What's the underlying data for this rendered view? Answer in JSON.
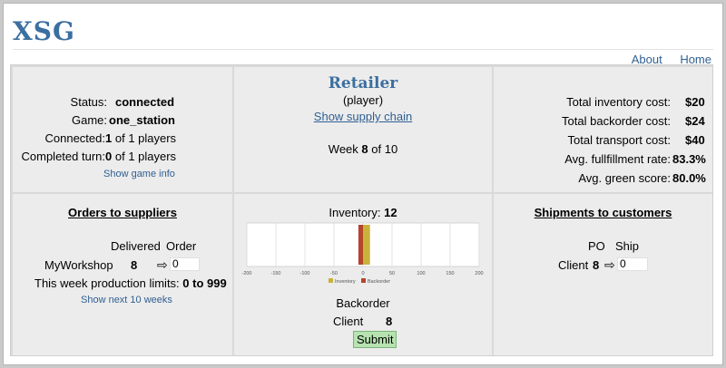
{
  "app": {
    "logo": "XSG"
  },
  "nav": {
    "about": "About",
    "home": "Home"
  },
  "status_panel": {
    "status_label": "Status:",
    "status_value": "connected",
    "game_label": "Game:",
    "game_value": "one_station",
    "connected_label": "Connected:",
    "connected_count": "1",
    "connected_suffix": "of 1 players",
    "completed_label": "Completed turn:",
    "completed_count": "0",
    "completed_suffix": "of 1 players",
    "show_game_info": "Show game info"
  },
  "role_panel": {
    "role": "Retailer",
    "role_type": "(player)",
    "show_supply_chain": "Show supply chain",
    "week_prefix": "Week",
    "week_current": "8",
    "week_suffix": "of 10"
  },
  "costs_panel": {
    "rows": [
      {
        "label": "Total inventory cost:",
        "value": "$20"
      },
      {
        "label": "Total backorder cost:",
        "value": "$24"
      },
      {
        "label": "Total transport cost:",
        "value": "$40"
      },
      {
        "label": "Avg. fullfillment rate:",
        "value": "83.3%"
      },
      {
        "label": "Avg. green score:",
        "value": "80.0%"
      }
    ]
  },
  "orders_panel": {
    "title": "Orders to suppliers",
    "col_delivered": "Delivered",
    "col_order": "Order",
    "supplier_name": "MyWorkshop",
    "supplier_delivered": "8",
    "arrow": "⇨",
    "order_value": "0",
    "limits_label": "This week production limits:",
    "limits_value": "0 to 999",
    "show_next": "Show next 10 weeks"
  },
  "inventory_panel": {
    "inventory_label": "Inventory:",
    "inventory_value": "12",
    "backorder_label": "Backorder",
    "client_label": "Client",
    "client_backorder": "8",
    "submit_label": "Submit"
  },
  "shipments_panel": {
    "title": "Shipments to customers",
    "col_po": "PO",
    "col_ship": "Ship",
    "client_label": "Client",
    "client_po": "8",
    "arrow": "⇨",
    "ship_value": "0"
  },
  "chart_data": {
    "type": "bar",
    "orientation": "horizontal",
    "series": [
      {
        "name": "Inventory",
        "values": [
          12
        ]
      },
      {
        "name": "Backorder",
        "values": [
          -8
        ]
      }
    ],
    "xlim": [
      -200,
      200
    ],
    "xticks": [
      -200,
      -150,
      -100,
      -50,
      0,
      50,
      100,
      150,
      200
    ],
    "grid": true,
    "legend": "bottom",
    "colors": {
      "Inventory": "#c9b23a",
      "Backorder": "#b5452d"
    }
  }
}
